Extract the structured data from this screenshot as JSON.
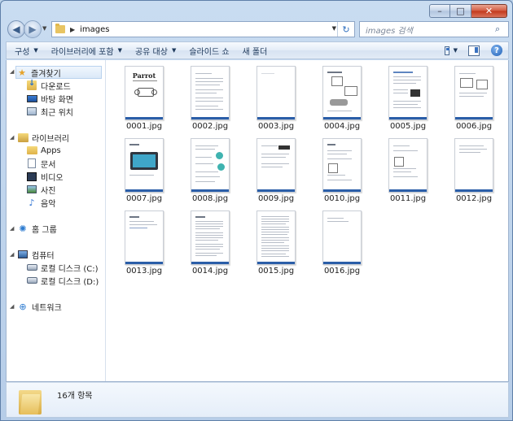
{
  "window": {
    "caption_min": "–",
    "caption_max": "□",
    "caption_close": "✕"
  },
  "address": {
    "back_glyph": "◀",
    "forward_glyph": "▶",
    "separator": "▶",
    "path": "images",
    "refresh_glyph": "↻"
  },
  "search": {
    "placeholder": "images 검색",
    "icon": "search-icon"
  },
  "toolbar": {
    "organize": "구성",
    "include_library": "라이브러리에 포함",
    "share_with": "공유 대상",
    "slideshow": "슬라이드 쇼",
    "new_folder": "새 폴더",
    "help": "?"
  },
  "sidebar": {
    "favorites": {
      "label": "즐겨찾기",
      "items": [
        {
          "label": "다운로드",
          "icon": "downloads-icon"
        },
        {
          "label": "바탕 화면",
          "icon": "desktop-icon"
        },
        {
          "label": "최근 위치",
          "icon": "recent-places-icon"
        }
      ]
    },
    "libraries": {
      "label": "라이브러리",
      "items": [
        {
          "label": "Apps",
          "icon": "folder-icon"
        },
        {
          "label": "문서",
          "icon": "documents-icon"
        },
        {
          "label": "비디오",
          "icon": "videos-icon"
        },
        {
          "label": "사진",
          "icon": "pictures-icon"
        },
        {
          "label": "음악",
          "icon": "music-icon"
        }
      ]
    },
    "homegroup": {
      "label": "홈 그룹",
      "icon": "homegroup-icon"
    },
    "computer": {
      "label": "컴퓨터",
      "items": [
        {
          "label": "로컬 디스크 (C:)",
          "icon": "windows-disk-icon"
        },
        {
          "label": "로컬 디스크 (D:)",
          "icon": "disk-icon"
        }
      ]
    },
    "network": {
      "label": "네트워크",
      "icon": "network-icon"
    }
  },
  "files": [
    "0001.jpg",
    "0002.jpg",
    "0003.jpg",
    "0004.jpg",
    "0005.jpg",
    "0006.jpg",
    "0007.jpg",
    "0008.jpg",
    "0009.jpg",
    "0010.jpg",
    "0011.jpg",
    "0012.jpg",
    "0013.jpg",
    "0014.jpg",
    "0015.jpg",
    "0016.jpg"
  ],
  "thumbnail_text": {
    "brand_line1": "Parrot"
  },
  "details": {
    "item_count": "16개 항목"
  },
  "colors": {
    "accent": "#2b5ea8",
    "frame": "#bcd3ea"
  }
}
